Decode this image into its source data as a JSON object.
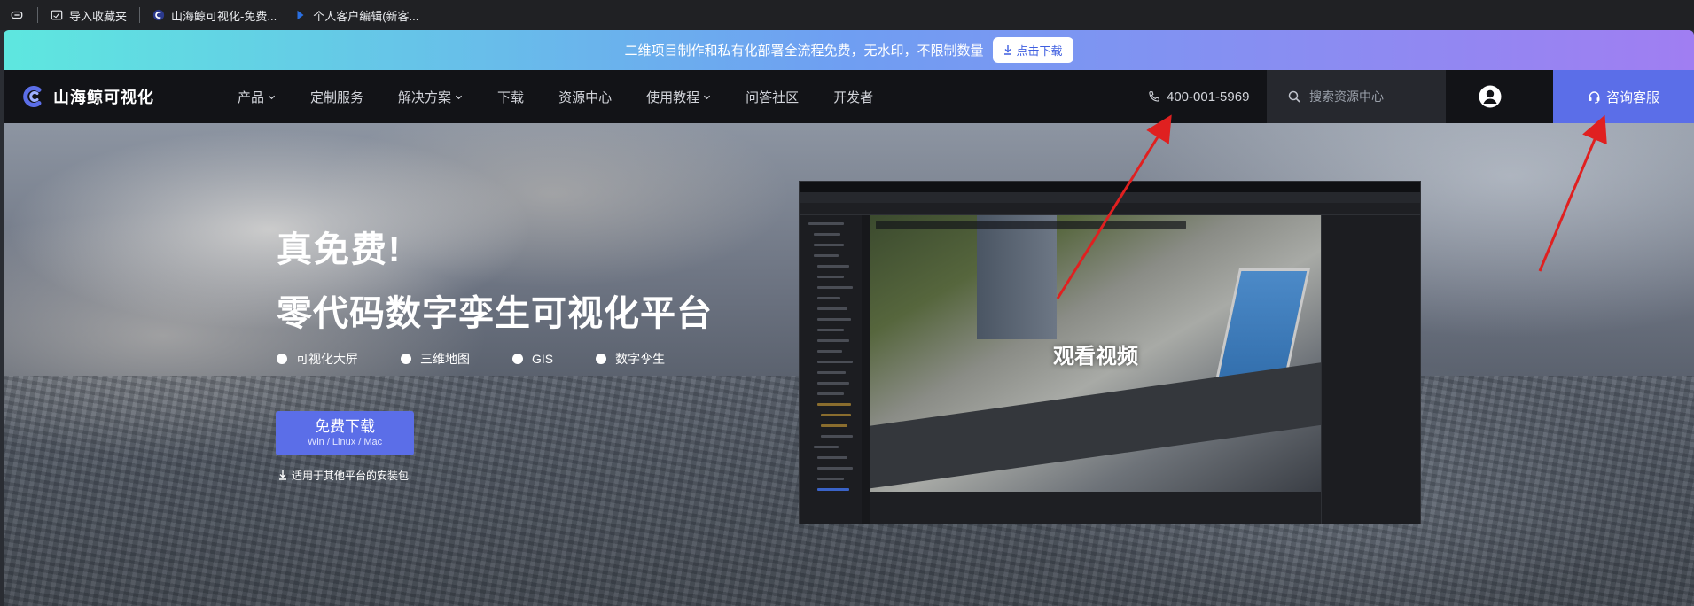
{
  "bookmarks": {
    "items": [
      {
        "label": "导入收藏夹",
        "icon": "folder-icon"
      },
      {
        "label": "山海鲸可视化-免费...",
        "icon": "site-favicon-icon"
      },
      {
        "label": "个人客户编辑(新客...",
        "icon": "bookmark-favicon-icon"
      }
    ]
  },
  "promo": {
    "text": "二维项目制作和私有化部署全流程免费，无水印，不限制数量",
    "button_label": "点击下载"
  },
  "nav": {
    "logo_text": "山海鲸可视化",
    "menu": [
      {
        "label": "产品",
        "dropdown": true
      },
      {
        "label": "定制服务",
        "dropdown": false
      },
      {
        "label": "解决方案",
        "dropdown": true
      },
      {
        "label": "下载",
        "dropdown": false
      },
      {
        "label": "资源中心",
        "dropdown": false
      },
      {
        "label": "使用教程",
        "dropdown": true
      },
      {
        "label": "问答社区",
        "dropdown": false
      },
      {
        "label": "开发者",
        "dropdown": false
      }
    ],
    "phone": "400-001-5969",
    "search_placeholder": "搜索资源中心",
    "consult_label": "咨询客服"
  },
  "hero": {
    "title1": "真免费!",
    "title2": "零代码数字孪生可视化平台",
    "tags": [
      "可视化大屏",
      "三维地图",
      "GIS",
      "数字孪生"
    ],
    "download_main": "免费下载",
    "download_sub": "Win / Linux / Mac",
    "other_platforms": "适用于其他平台的安装包",
    "video_label": "观看视频"
  },
  "colors": {
    "accent": "#5b6ee8",
    "nav_bg": "#121317",
    "annotation": "#e02020"
  }
}
